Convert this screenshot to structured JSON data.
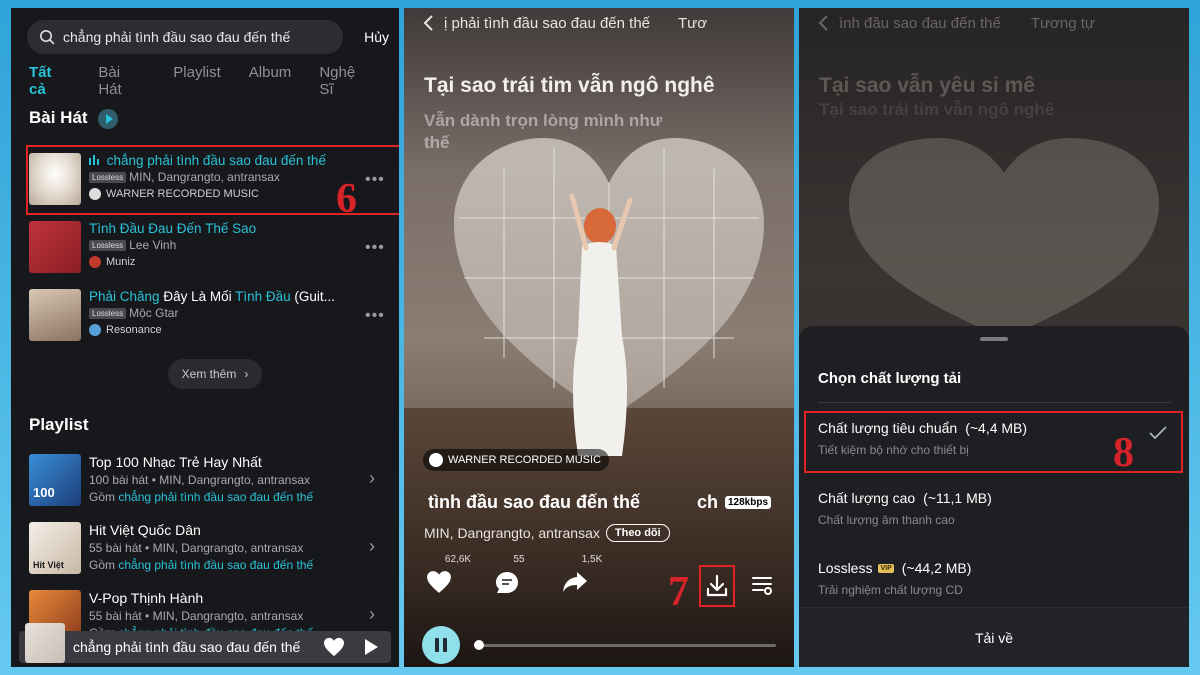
{
  "search": {
    "query": "chẳng phải tình đầu sao đau đến thế",
    "cancel": "Hủy"
  },
  "tabs": [
    "Tất cả",
    "Bài Hát",
    "Playlist",
    "Album",
    "Nghệ Sĩ"
  ],
  "songs_section": {
    "title": "Bài Hát"
  },
  "songs": [
    {
      "title": "chẳng phải tình đầu sao đau đến thế",
      "badge": "Lossless",
      "artist": "MIN, Dangrangto, antransax",
      "label": "WARNER RECORDED MUSIC"
    },
    {
      "title": "Tình Đầu Đau Đến Thế Sao",
      "badge": "Lossless",
      "artist": "Lee Vinh",
      "label": "Muniz"
    },
    {
      "title_parts": [
        "Phải Chăng",
        " Đây Là Mối ",
        "Tình Đầu",
        " (Guit..."
      ],
      "badge": "Lossless",
      "artist": "Mộc Gtar",
      "label": "Resonance"
    }
  ],
  "more_label": "Xem thêm",
  "playlist_section": {
    "title": "Playlist"
  },
  "playlists": [
    {
      "title": "Top 100 Nhạc Trẻ Hay Nhất",
      "meta": "100 bài hát • MIN, Dangrangto, antransax",
      "gom": "Gồm ",
      "gom_song": "chẳng phải tình đầu sao đau đến thế",
      "thumb_text": "100"
    },
    {
      "title": "Hit Việt Quốc Dân",
      "meta": "55 bài hát • MIN, Dangrangto, antransax",
      "gom": "Gồm ",
      "gom_song": "chẳng phải tình đầu sao đau đến thế",
      "thumb_text": "Hit Việt"
    },
    {
      "title": "V-Pop Thịnh Hành",
      "meta": "55 bài hát • MIN, Dangrangto, antransax",
      "gom": "Gồm ",
      "gom_song": "chẳng phải tình đầu sao đau đến thế",
      "thumb_text": ""
    }
  ],
  "mini_player": {
    "title": "chẳng phải tình đầu sao đau đến thế"
  },
  "steps": {
    "six": "6",
    "seven": "7",
    "eight": "8"
  },
  "player": {
    "header": "ị phải tình đầu sao đau đến thế",
    "header_right": "Tươ",
    "lyric_current": "Tại sao trái tim vẫn ngô nghê",
    "lyric_next": "Vẫn dành trọn lòng mình như thế",
    "label": "WARNER RECORDED MUSIC",
    "title": "tình đầu sao đau đến thế",
    "title_scroll": "ch",
    "quality": "128kbps",
    "artist": "MIN, Dangrangto, antransax",
    "follow": "Theo dõi",
    "likes": "62,6K",
    "comments": "55",
    "shares": "1,5K"
  },
  "quality_sheet": {
    "header": "ình đầu sao đau đến thế",
    "header_right": "Tương tự",
    "lyric_prev": "Tại sao vẫn yêu si mê",
    "lyric_current": "Tại sao trái tim vẫn ngô nghê",
    "title": "Chọn chất lượng tải",
    "options": [
      {
        "name": "Chất lượng tiêu chuẩn",
        "size": "(~4,4 MB)",
        "desc": "Tiết kiệm bộ nhớ cho thiết bị"
      },
      {
        "name": "Chất lượng cao",
        "size": "(~11,1 MB)",
        "desc": "Chất lượng âm thanh cao"
      },
      {
        "name": "Lossless",
        "vip": "VIP",
        "size": "(~44,2 MB)",
        "desc": "Trải nghiệm chất lượng CD"
      }
    ],
    "download": "Tải về"
  },
  "colors": {
    "accent": "#29c2d6",
    "highlight": "#e02424",
    "step_number": "#d8232a",
    "frame": "#4fb8e8"
  }
}
